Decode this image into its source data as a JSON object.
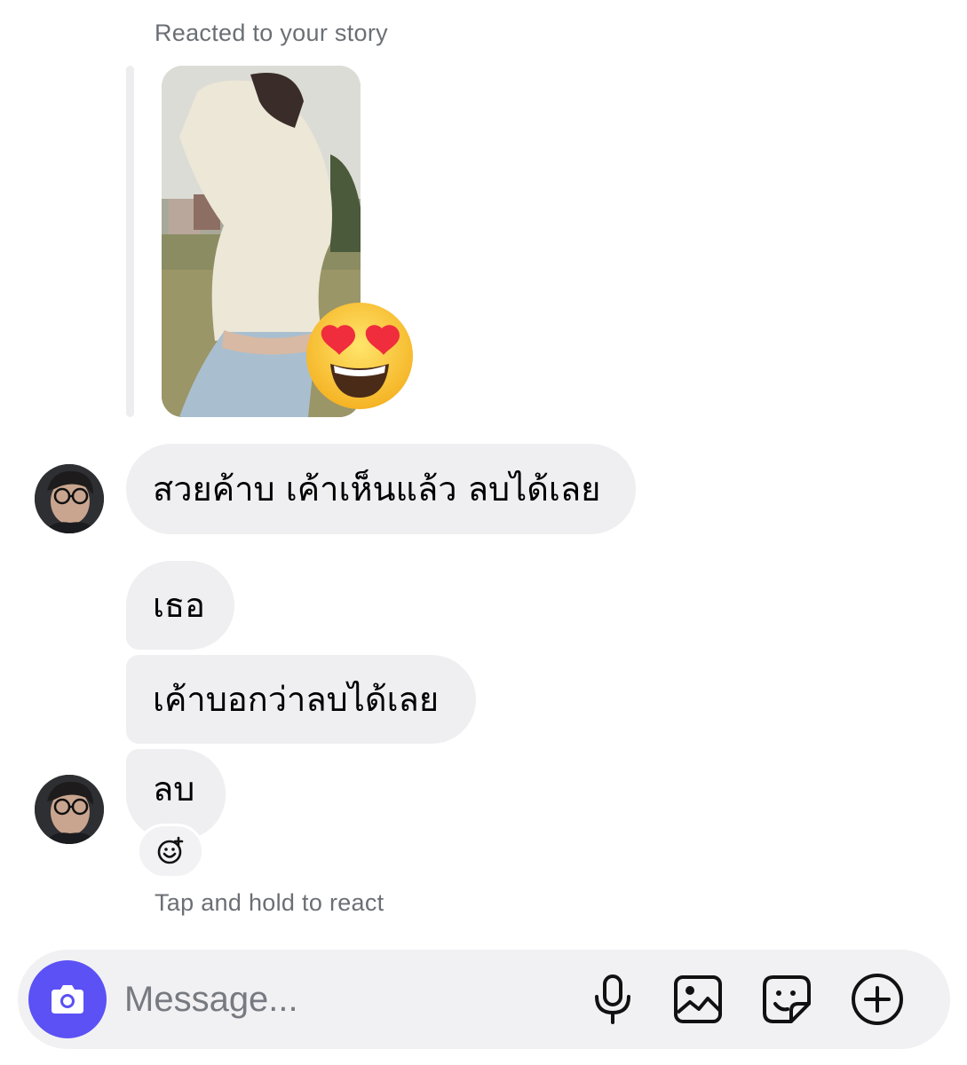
{
  "story": {
    "caption": "Reacted to your story",
    "reaction": "😍"
  },
  "messages": [
    {
      "text": "สวยค้าบ เค้าเห็นแล้ว ลบได้เลย"
    },
    {
      "text": "เธอ"
    },
    {
      "text": "เค้าบอกว่าลบได้เลย"
    },
    {
      "text": "ลบ"
    }
  ],
  "hint": "Tap and hold to react",
  "composer": {
    "placeholder": "Message...",
    "icons": [
      "camera-icon",
      "microphone-icon",
      "gallery-icon",
      "sticker-icon",
      "plus-circle-icon"
    ]
  },
  "colors": {
    "accent": "#5b51f5",
    "bubble": "#efeff1",
    "muted_text": "#6b6f75"
  }
}
